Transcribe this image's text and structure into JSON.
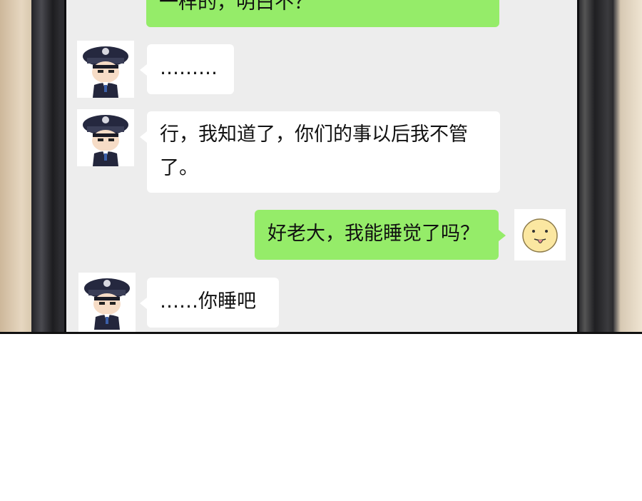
{
  "chat": {
    "messages": [
      {
        "sender": "self",
        "avatar": "none",
        "text": "一样的，明白不？"
      },
      {
        "sender": "police",
        "avatar": "police-officer-avatar",
        "text": "………"
      },
      {
        "sender": "police",
        "avatar": "police-officer-avatar",
        "text": "行，我知道了，你们的事以后我不管了。"
      },
      {
        "sender": "self",
        "avatar": "tongue-out-face-avatar",
        "text": "好老大，我能睡觉了吗？"
      },
      {
        "sender": "police",
        "avatar": "police-officer-avatar",
        "text": "……你睡吧"
      }
    ]
  },
  "colors": {
    "screen_bg": "#ededed",
    "incoming_bubble": "#ffffff",
    "outgoing_bubble": "#95ec69",
    "police_uniform": "#23263c",
    "smiley_face": "#fbe7a1"
  }
}
